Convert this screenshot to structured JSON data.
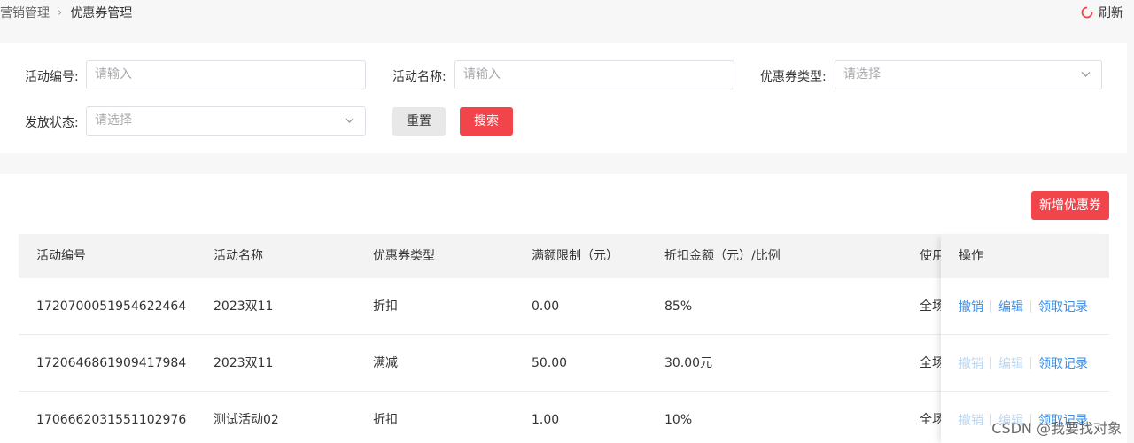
{
  "breadcrumb": {
    "parent": "营销管理",
    "current": "优惠券管理"
  },
  "refresh_label": "刷新",
  "filters": {
    "activity_no": {
      "label": "活动编号:",
      "placeholder": "请输入"
    },
    "activity_name": {
      "label": "活动名称:",
      "placeholder": "请输入"
    },
    "coupon_type": {
      "label": "优惠券类型:",
      "placeholder": "请选择"
    },
    "issue_status": {
      "label": "发放状态:",
      "placeholder": "请选择"
    },
    "reset_label": "重置",
    "search_label": "搜索"
  },
  "add_button_label": "新增优惠券",
  "table": {
    "headers": [
      "活动编号",
      "活动名称",
      "优惠券类型",
      "满额限制（元）",
      "折扣金额（元）/比例",
      "使用"
    ],
    "action_header": "操作",
    "rows": [
      {
        "id": "1720700051954622464",
        "name": "2023双11",
        "type": "折扣",
        "threshold": "0.00",
        "discount": "85%",
        "scope": "全场",
        "actions": {
          "revoke": "撤销",
          "edit": "编辑",
          "records": "领取记录"
        }
      },
      {
        "id": "1720646861909417984",
        "name": "2023双11",
        "type": "满减",
        "threshold": "50.00",
        "discount": "30.00元",
        "scope": "全场",
        "actions": {
          "revoke": "撤销",
          "edit": "编辑",
          "records": "领取记录"
        }
      },
      {
        "id": "1706662031551102976",
        "name": "测试活动02",
        "type": "折扣",
        "threshold": "1.00",
        "discount": "10%",
        "scope": "全场",
        "actions": {
          "revoke": "撤销",
          "edit": "编辑",
          "records": "领取记录"
        }
      }
    ]
  },
  "watermark": "CSDN @我要找对象",
  "colors": {
    "primary_red": "#f2444b",
    "link_blue": "#3a8ee6",
    "link_disabled": "#b9d7f3"
  }
}
